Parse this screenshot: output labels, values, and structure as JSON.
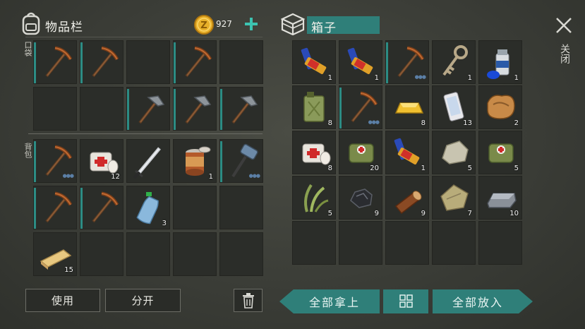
{
  "left_panel": {
    "title": "物品栏",
    "coins": "927",
    "pocket_label": "口袋",
    "backpack_label": "背包"
  },
  "right_panel": {
    "title": "箱子",
    "close_label": "关闭"
  },
  "buttons": {
    "use": "使用",
    "split": "分开",
    "take_all": "全部拿上",
    "put_all": "全部放入"
  },
  "pocket_slots": [
    {
      "item": "pickaxe-icon",
      "count": ""
    },
    {
      "item": "pickaxe-icon",
      "count": ""
    },
    {
      "item": "",
      "count": ""
    },
    {
      "item": "pickaxe-icon",
      "count": ""
    },
    {
      "item": "",
      "count": ""
    },
    {
      "item": "",
      "count": ""
    },
    {
      "item": "",
      "count": ""
    },
    {
      "item": "stone-pickaxe-icon",
      "count": ""
    },
    {
      "item": "stone-pickaxe-icon",
      "count": ""
    },
    {
      "item": "stone-pickaxe-icon",
      "count": ""
    }
  ],
  "backpack_slots": [
    {
      "item": "pickaxe-icon",
      "count": ""
    },
    {
      "item": "bandage-icon",
      "count": "12"
    },
    {
      "item": "sword-icon",
      "count": ""
    },
    {
      "item": "canned-food-icon",
      "count": "1"
    },
    {
      "item": "sledgehammer-icon",
      "count": ""
    },
    {
      "item": "pickaxe-icon",
      "count": ""
    },
    {
      "item": "pickaxe-icon",
      "count": ""
    },
    {
      "item": "water-bottle-icon",
      "count": "3"
    },
    {
      "item": "",
      "count": ""
    },
    {
      "item": "",
      "count": ""
    },
    {
      "item": "plank-icon",
      "count": "15"
    },
    {
      "item": "",
      "count": ""
    },
    {
      "item": "",
      "count": ""
    },
    {
      "item": "",
      "count": ""
    },
    {
      "item": "",
      "count": ""
    }
  ],
  "chest_slots": [
    {
      "item": "battery-icon",
      "count": "1"
    },
    {
      "item": "battery-icon",
      "count": "1"
    },
    {
      "item": "pickaxe-icon",
      "count": ""
    },
    {
      "item": "key-icon",
      "count": "1"
    },
    {
      "item": "spray-can-icon",
      "count": "1"
    },
    {
      "item": "jerrycan-icon",
      "count": "8"
    },
    {
      "item": "pickaxe-icon",
      "count": ""
    },
    {
      "item": "gold-bar-icon",
      "count": "8"
    },
    {
      "item": "phone-icon",
      "count": "13"
    },
    {
      "item": "leather-icon",
      "count": "2"
    },
    {
      "item": "bandage-icon",
      "count": "8"
    },
    {
      "item": "first-aid-bag-icon",
      "count": "20"
    },
    {
      "item": "battery-icon",
      "count": "1"
    },
    {
      "item": "stone-icon",
      "count": "5"
    },
    {
      "item": "first-aid-bag-icon",
      "count": "5"
    },
    {
      "item": "plant-fiber-icon",
      "count": "5"
    },
    {
      "item": "coal-icon",
      "count": "9"
    },
    {
      "item": "log-icon",
      "count": "9"
    },
    {
      "item": "cloth-icon",
      "count": "7"
    },
    {
      "item": "iron-bar-icon",
      "count": "10"
    },
    {
      "item": "",
      "count": ""
    },
    {
      "item": "",
      "count": ""
    },
    {
      "item": "",
      "count": ""
    },
    {
      "item": "",
      "count": ""
    },
    {
      "item": "",
      "count": ""
    }
  ],
  "colors": {
    "accent": "#2f7f79",
    "slot_bg": "#2b2d29",
    "coin": "#e8b02a"
  }
}
